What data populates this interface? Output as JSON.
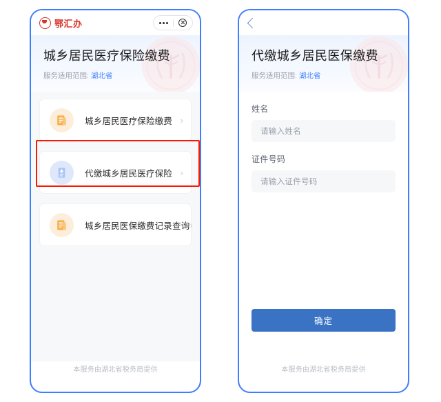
{
  "left_panel": {
    "miniapp_bar": {
      "brand_name": "鄂汇办",
      "more_icon": "more-dots-icon",
      "close_icon": "close-circle-icon"
    },
    "header": {
      "title": "城乡居民医疗保险缴费",
      "scope_label": "服务适用范围:",
      "scope_value": "湖北省",
      "watermark_icon": "agency-emblem-watermark"
    },
    "services": [
      {
        "label": "城乡居民医疗保险缴费",
        "icon": "document-icon",
        "icon_theme": "orange",
        "chevron": "›",
        "highlighted": false
      },
      {
        "label": "代缴城乡居民医疗保险",
        "icon": "id-card-icon",
        "icon_theme": "blue",
        "chevron": "›",
        "highlighted": true
      },
      {
        "label": "城乡居民医保缴费记录查询",
        "icon": "document-icon",
        "icon_theme": "orange",
        "chevron": "›",
        "highlighted": false
      }
    ],
    "footer_text": "本服务由湖北省税务局提供"
  },
  "right_panel": {
    "nav": {
      "back_icon": "back-chevron-icon"
    },
    "header": {
      "title": "代缴城乡居民医保缴费",
      "scope_label": "服务适用范围:",
      "scope_value": "湖北省",
      "watermark_icon": "agency-emblem-watermark"
    },
    "form": {
      "fields": [
        {
          "label": "姓名",
          "value": "",
          "placeholder": "请输入姓名"
        },
        {
          "label": "证件号码",
          "value": "",
          "placeholder": "请输入证件号码"
        }
      ],
      "submit_label": "确定"
    },
    "footer_text": "本服务由湖北省税务局提供"
  },
  "colors": {
    "panel_border": "#3d7eff",
    "brand_red": "#d8342a",
    "link_blue": "#3d7eff",
    "highlight_red": "#fb1700",
    "submit_blue": "#3a72c4",
    "icon_orange_bg": "#fdeedb",
    "icon_blue_bg": "#dfe8fb"
  }
}
